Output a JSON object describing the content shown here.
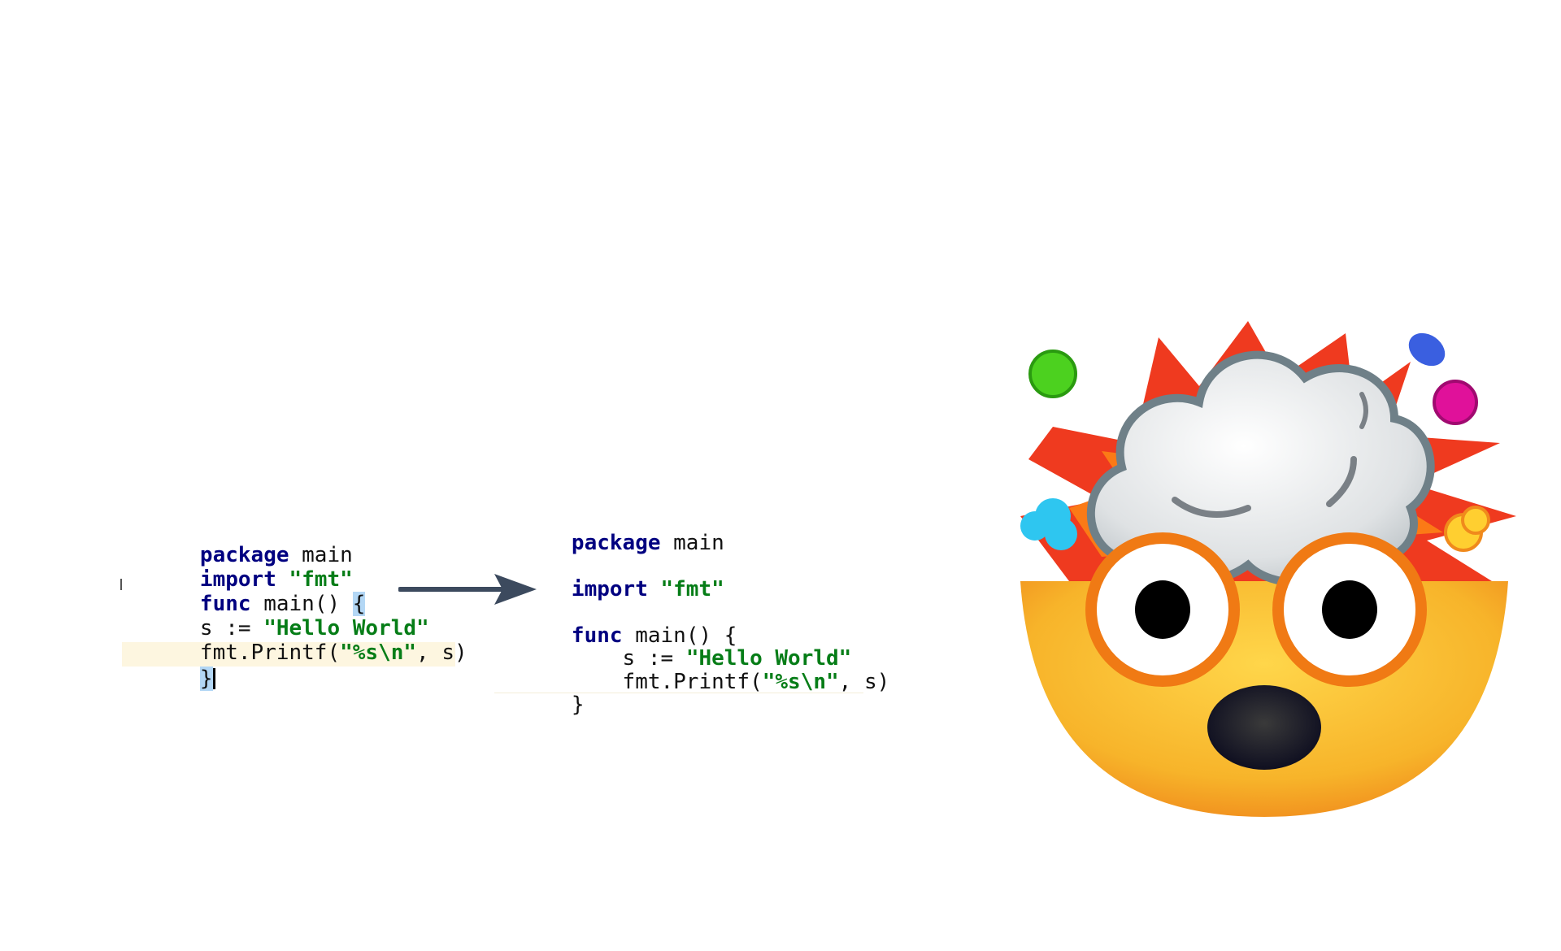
{
  "before": {
    "line1": {
      "kw": "package",
      "rest": " main"
    },
    "line2": {
      "kw": "import",
      "sp": " ",
      "str": "\"fmt\""
    },
    "line3": {
      "kw": "func",
      "rest": " main() ",
      "brace": "{"
    },
    "line4": {
      "a": "s := ",
      "str": "\"Hello World\""
    },
    "line5": {
      "a": "fmt.Printf(",
      "str": "\"%s\\n\"",
      "b": ", s)"
    },
    "line6": {
      "brace": "}"
    }
  },
  "after": {
    "line1": {
      "kw": "package",
      "rest": " main"
    },
    "line2": {
      "kw": "import",
      "sp": " ",
      "str": "\"fmt\""
    },
    "line3": {
      "kw": "func",
      "rest": " main() {"
    },
    "line4": {
      "a": "    s := ",
      "str": "\"Hello World\""
    },
    "line5": {
      "a": "    fmt.Printf(",
      "str": "\"%s\\n\"",
      "b": ", s)"
    },
    "line6": {
      "a": "}"
    }
  },
  "colors": {
    "keyword": "#000080",
    "string": "#067d17",
    "arrow": "#3c4a5e",
    "brace_highlight": "#b3d7f5",
    "current_line": "#fdf6e0"
  },
  "icons": {
    "arrow": "right-arrow-icon",
    "emoji": "exploding-head-emoji-icon"
  }
}
